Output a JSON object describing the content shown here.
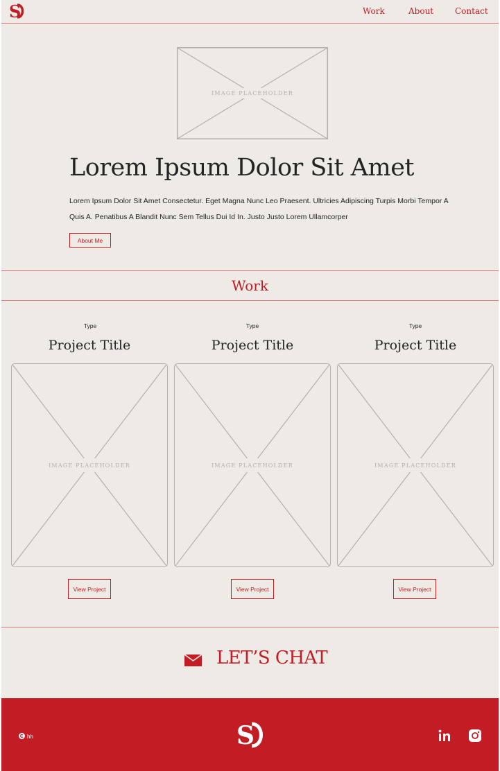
{
  "nav": {
    "work": "Work",
    "about": "About",
    "contact": "Contact"
  },
  "hero": {
    "image_placeholder": "IMAGE PLACEHOLDER",
    "title": "Lorem Ipsum Dolor Sit Amet",
    "paragraph": "Lorem Ipsum Dolor Sit Amet Consectetur. Eget Magna Nunc Leo Praesent. Ultricies Adipiscing Turpis Morbi Tempor A Quis A. Penatibus A Blandit Nunc Sem Tellus Dui Id In. Justo Justo Lorem Ullamcorper",
    "about_button": "About Me"
  },
  "work": {
    "heading": "Work",
    "projects": [
      {
        "type": "Type",
        "title": "Project Title",
        "image_placeholder": "IMAGE PLACEHOLDER",
        "button": "View Project"
      },
      {
        "type": "Type",
        "title": "Project Title",
        "image_placeholder": "IMAGE PLACEHOLDER",
        "button": "View Project"
      },
      {
        "type": "Type",
        "title": "Project Title",
        "image_placeholder": "IMAGE PLACEHOLDER",
        "button": "View Project"
      }
    ]
  },
  "chat": {
    "label": "LET’S CHAT",
    "icon": "mail-icon"
  },
  "footer": {
    "copyright": "hh",
    "icons": [
      "copyright-icon",
      "linkedin-icon",
      "instagram-icon"
    ]
  },
  "colors": {
    "accent": "#c21d24",
    "background": "#eeeae5",
    "divider": "#d9797b",
    "placeholder": "#b3b0ac",
    "text": "#242424"
  }
}
